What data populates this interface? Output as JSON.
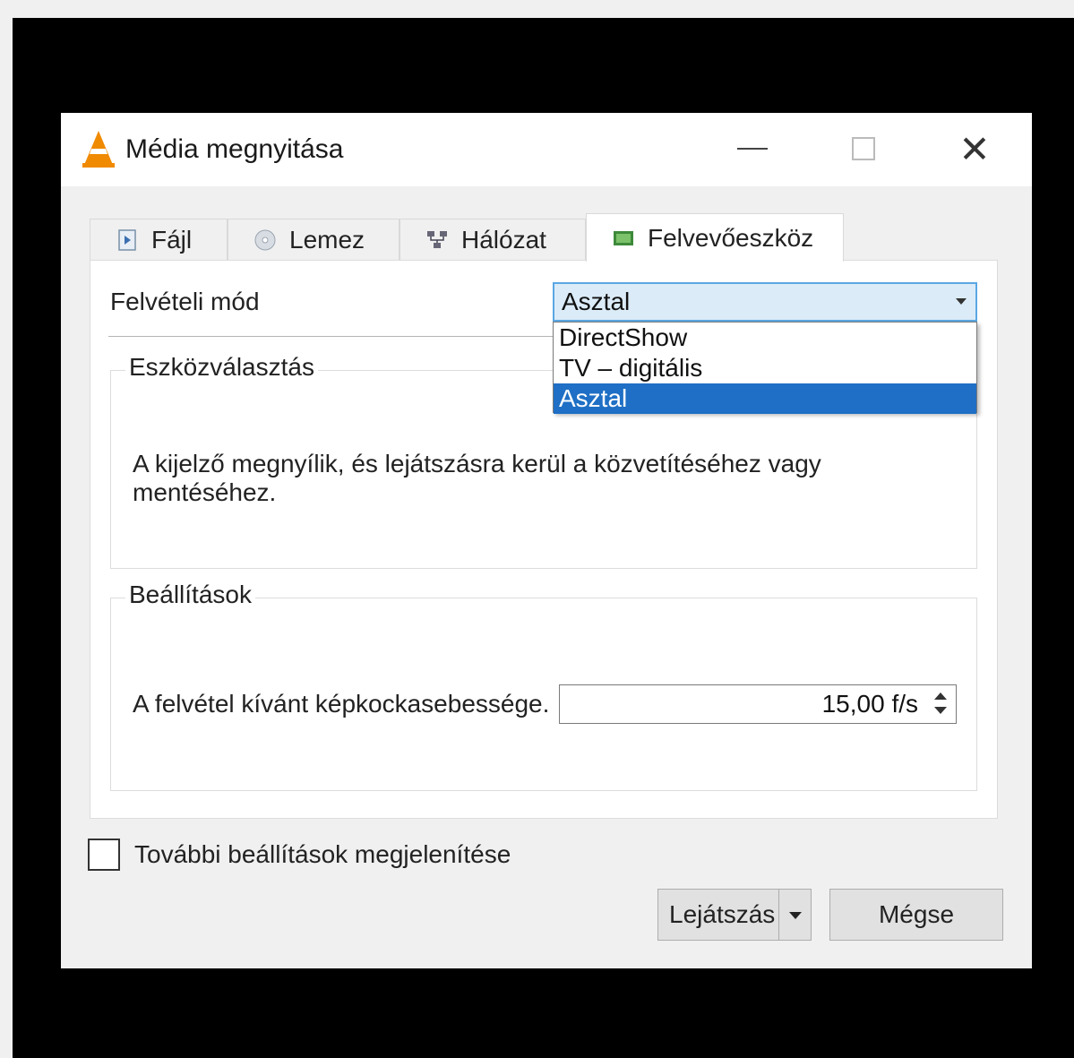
{
  "window": {
    "title": "Média megnyitása",
    "icon": "vlc-cone-icon",
    "controls": [
      "minimize-icon",
      "maximize-icon",
      "close-icon"
    ],
    "close_glyph": "✕"
  },
  "tabs": [
    {
      "label": "Fájl",
      "icon": "file-icon"
    },
    {
      "label": "Lemez",
      "icon": "disc-icon"
    },
    {
      "label": "Hálózat",
      "icon": "network-icon"
    },
    {
      "label": "Felvevőeszköz",
      "icon": "capture-device-icon",
      "active": true
    }
  ],
  "capture": {
    "mode_label": "Felvételi mód",
    "mode_value": "Asztal",
    "mode_options": [
      "DirectShow",
      "TV – digitális",
      "Asztal"
    ],
    "selected_option": "Asztal"
  },
  "device_group": {
    "title": "Eszközválasztás",
    "description": "A kijelző megnyílik, és lejátszásra kerül a közvetítéséhez vagy mentéséhez."
  },
  "settings_group": {
    "title": "Beállítások",
    "fps_label": "A felvétel kívánt képkockasebessége.",
    "fps_value": "15,00 f/s"
  },
  "more_options": {
    "label": "További beállítások megjelenítése",
    "checked": false
  },
  "buttons": {
    "play": "Lejátszás",
    "cancel": "Mégse"
  },
  "colors": {
    "accent": "#1e6fc5",
    "combo_bg": "#dbecf8",
    "vlc_orange": "#f08a00"
  }
}
